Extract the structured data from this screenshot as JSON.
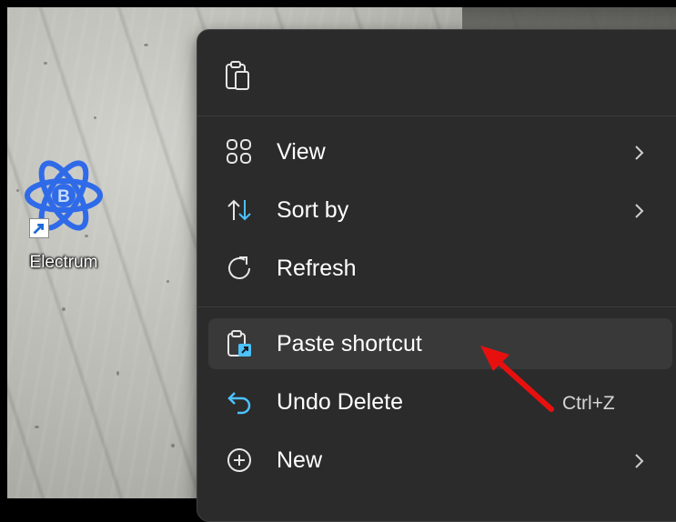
{
  "desktop": {
    "icon": {
      "label": "Electrum",
      "icon": "electrum-atom-icon"
    }
  },
  "context_menu": {
    "top_icons": [
      {
        "icon": "paste-icon"
      }
    ],
    "items": [
      {
        "label": "View",
        "icon": "view-grid-icon",
        "submenu": true
      },
      {
        "label": "Sort by",
        "icon": "sort-arrows-icon",
        "submenu": true
      },
      {
        "label": "Refresh",
        "icon": "refresh-icon",
        "submenu": false
      },
      {
        "label": "Paste shortcut",
        "icon": "paste-shortcut-icon",
        "submenu": false,
        "highlighted": true
      },
      {
        "label": "Undo Delete",
        "icon": "undo-icon",
        "shortcut": "Ctrl+Z",
        "submenu": false
      },
      {
        "label": "New",
        "icon": "new-plus-icon",
        "submenu": true
      }
    ]
  },
  "annotation": {
    "color": "#e8100f",
    "icon": "red-arrow-pointer"
  },
  "colors": {
    "menu_bg": "#2b2b2b",
    "highlight": "#393939",
    "accent": "#4cc2ff",
    "electrum_blue": "#2f6be8"
  }
}
